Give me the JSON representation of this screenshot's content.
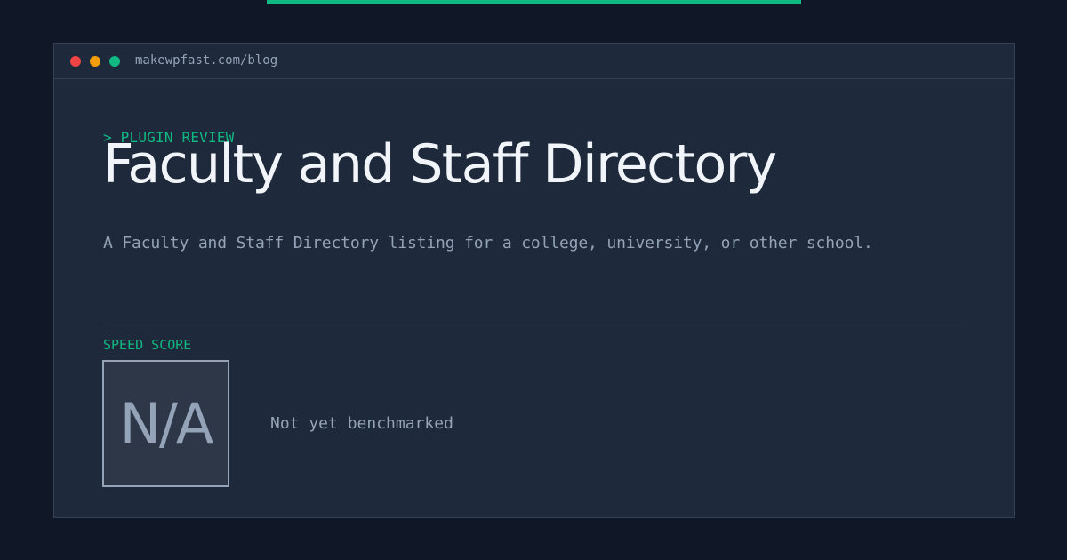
{
  "colors": {
    "accent": "#10b981",
    "traffic_red": "#ef4444",
    "traffic_yellow": "#f59e0b",
    "traffic_green": "#10b981"
  },
  "browser": {
    "url": "makewpfast.com/blog"
  },
  "article": {
    "eyebrow": "> PLUGIN REVIEW",
    "title": "Faculty and Staff Directory",
    "description": "A Faculty and Staff Directory listing for a college, university, or other school."
  },
  "speed": {
    "label": "SPEED SCORE",
    "value": "N/A",
    "status": "Not yet benchmarked"
  }
}
